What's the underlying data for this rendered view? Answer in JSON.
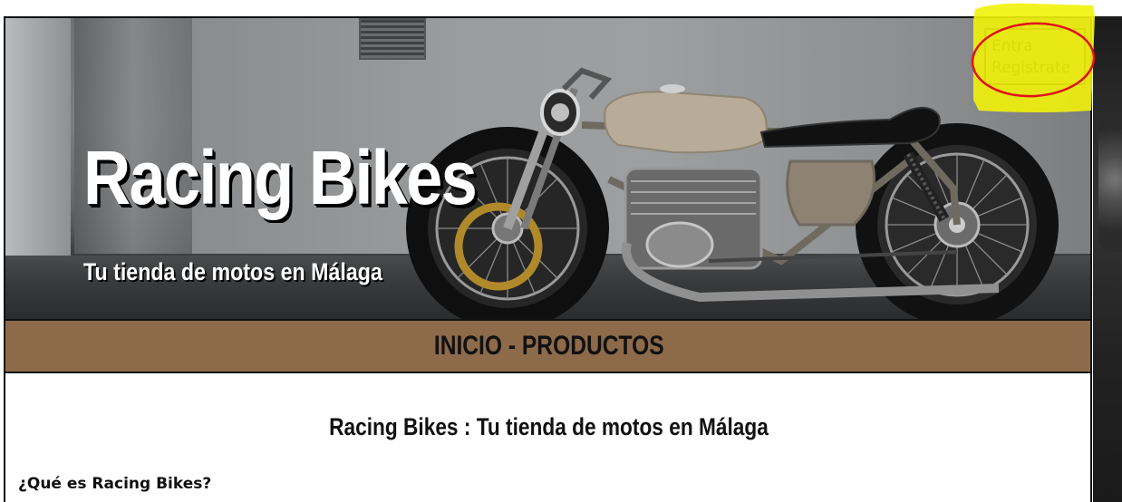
{
  "colors": {
    "nav_bg": "#8d6a49",
    "auth_bg": "#8a8a8a",
    "highlight_yellow": "#f2f20a",
    "circle_red": "#e0101a",
    "title_white": "#ffffff"
  },
  "auth": {
    "login_label": "Entra",
    "register_label": "Registrate"
  },
  "hero": {
    "title": "Racing Bikes",
    "subtitle": "Tu tienda de motos en Málaga"
  },
  "nav": {
    "items": [
      {
        "label": "INICIO"
      },
      {
        "label": "PRODUCTOS"
      }
    ],
    "separator": " - "
  },
  "content": {
    "heading": "Racing Bikes : Tu tienda de motos en Málaga",
    "question": "¿Qué es Racing Bikes?"
  },
  "icons": {
    "hero_image": "motorcycle-illustration"
  }
}
